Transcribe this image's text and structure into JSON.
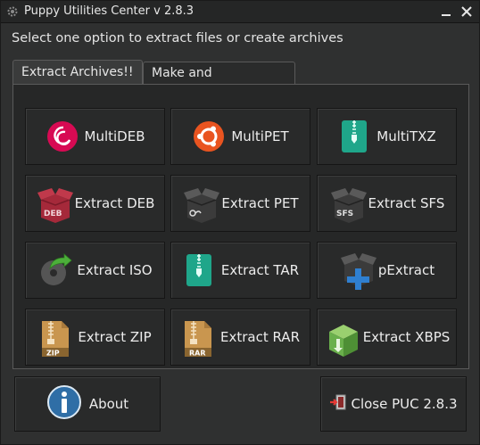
{
  "window": {
    "title": "Puppy Utilities Center v 2.8.3"
  },
  "prompt": "Select one option to extract files or create archives",
  "tabs": [
    {
      "label": "Extract Archives!!",
      "active": true
    },
    {
      "label": "Make and Compress!!",
      "active": false
    }
  ],
  "buttons": [
    {
      "label": "MultiDEB",
      "icon": "debian-icon"
    },
    {
      "label": "MultiPET",
      "icon": "ubuntu-icon"
    },
    {
      "label": "MultiTXZ",
      "icon": "zip-archive-icon"
    },
    {
      "label": "Extract DEB",
      "icon": "deb-box-icon"
    },
    {
      "label": "Extract PET",
      "icon": "pet-box-icon"
    },
    {
      "label": "Extract SFS",
      "icon": "sfs-box-icon"
    },
    {
      "label": "Extract ISO",
      "icon": "iso-disc-icon"
    },
    {
      "label": "Extract TAR",
      "icon": "tar-archive-icon"
    },
    {
      "label": "pExtract",
      "icon": "box-plus-icon"
    },
    {
      "label": "Extract ZIP",
      "icon": "zip-file-icon"
    },
    {
      "label": "Extract RAR",
      "icon": "rar-file-icon"
    },
    {
      "label": "Extract XBPS",
      "icon": "xbps-box-icon"
    }
  ],
  "icon_text": {
    "deb": "DEB",
    "sfs": "SFS",
    "zip": "ZIP",
    "rar": "RAR"
  },
  "footer": {
    "about_label": "About",
    "close_label": "Close PUC 2.8.3"
  },
  "colors": {
    "debian_red": "#d70a53",
    "ubuntu_orange": "#e95420",
    "teal_archive": "#1fa68a",
    "deb_box": "#a5293a",
    "info_blue": "#2f6ea6",
    "xbps_green": "#6ab04c"
  }
}
